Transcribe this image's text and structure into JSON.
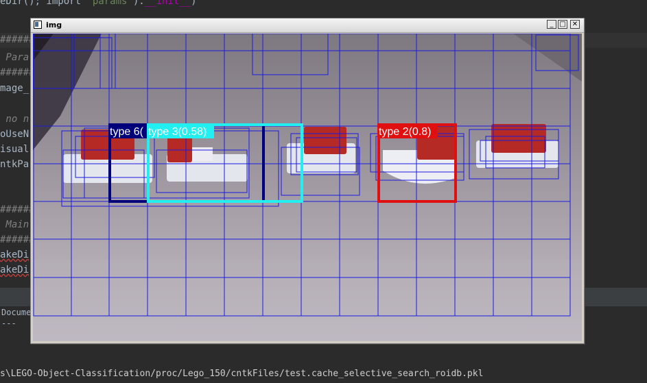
{
  "editor": {
    "top_line_prefix": "eDir(); import ",
    "top_line_str": "'params'",
    "top_line_dunder": "__init__",
    "lines": [
      "###########",
      " Para",
      "###########",
      "mage_",
      "",
      " no n",
      "oUseN",
      "isual",
      "ntkPa",
      "",
      "",
      "###########",
      " Main",
      "###########",
      "akeDi",
      "akeDi"
    ]
  },
  "panel": {
    "line1": "Docume",
    "line2": "---",
    "path": "s\\LEGO-Object-Classification/proc/Lego_150/cntkFiles/test.cache_selective_search_roidb.pkl"
  },
  "window": {
    "title": "img",
    "minimize": "_",
    "maximize": "□",
    "close": "✕"
  },
  "detections": [
    {
      "label": "type 6(",
      "color": "#00007b"
    },
    {
      "label": "type 3(0.58)",
      "color": "#22f0f0"
    },
    {
      "label": "type 2(0.8)",
      "color": "#e01010"
    }
  ],
  "colors": {
    "grid": "#1a1ae0",
    "brick_red": "#b52a25",
    "brick_white": "#e4e6ee"
  }
}
